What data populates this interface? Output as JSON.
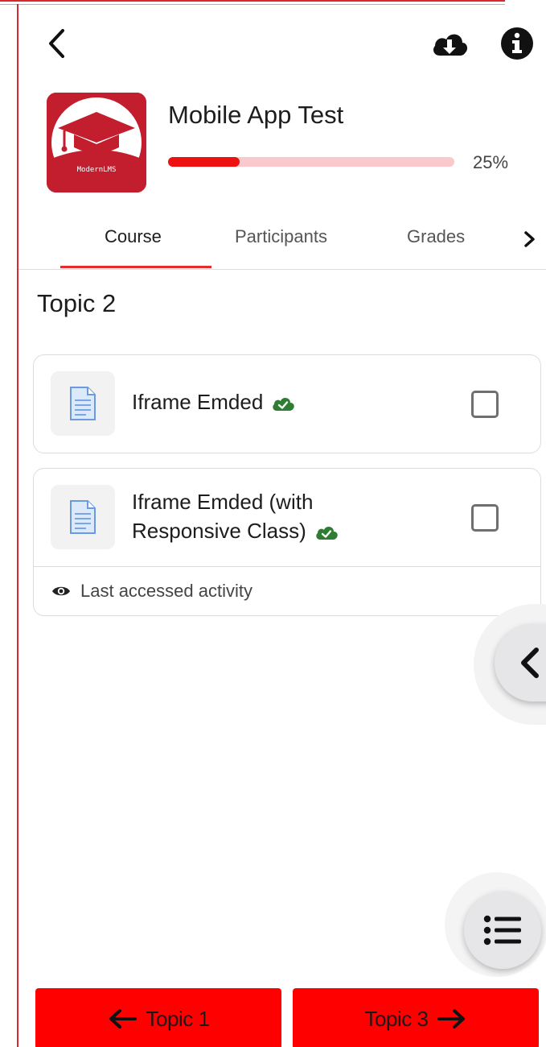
{
  "course": {
    "title": "Mobile App Test",
    "progress_label": "25%",
    "progress_fraction": 0.25,
    "logo_text": "ModernLMS"
  },
  "tabs": [
    {
      "label": "Course",
      "active": true
    },
    {
      "label": "Participants",
      "active": false
    },
    {
      "label": "Grades",
      "active": false
    }
  ],
  "section": {
    "title": "Topic 2"
  },
  "activities": [
    {
      "name": "Iframe Emded",
      "icon": "page-icon",
      "status_icon": "cloud-check-icon",
      "completed": false
    },
    {
      "name": "Iframe Emded (with Responsive Class)",
      "icon": "page-icon",
      "status_icon": "cloud-check-icon",
      "completed": false
    }
  ],
  "last_accessed_label": "Last accessed activity",
  "navigation": {
    "prev_label": "Topic 1",
    "next_label": "Topic 3"
  },
  "colors": {
    "accent": "#ff0000",
    "progress_fill": "#ee1111",
    "progress_track": "#f9c9cb",
    "tab_underline": "#e52b2b",
    "logo_bg": "#c21e2e",
    "cloud_check": "#2e7d32"
  },
  "icons": {
    "back": "chevron-left-icon",
    "download": "cloud-download-icon",
    "info": "info-icon",
    "tabs_next": "chevron-right-icon",
    "side_toggle": "chevron-left-icon",
    "fab": "list-icon",
    "last_accessed": "eye-icon"
  }
}
